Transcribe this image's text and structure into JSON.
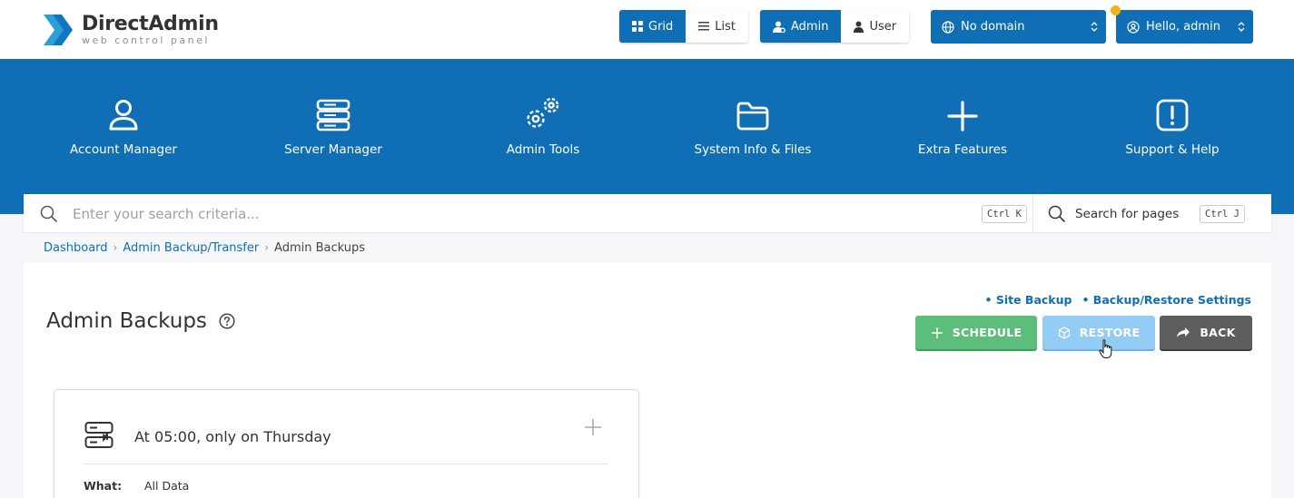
{
  "header": {
    "logo_name": "DirectAdmin",
    "logo_tagline": "web control panel",
    "view_toggle": {
      "grid_label": "Grid",
      "list_label": "List",
      "selected": "Grid"
    },
    "role_toggle": {
      "admin_label": "Admin",
      "user_label": "User",
      "selected": "Admin"
    },
    "domain_select": {
      "value": "No domain"
    },
    "user_menu": {
      "label": "Hello, admin"
    },
    "accent_color": "#0f6eb4",
    "notification_color": "#f3b41b"
  },
  "nav": {
    "items": [
      {
        "label": "Account Manager",
        "icon": "user-icon"
      },
      {
        "label": "Server Manager",
        "icon": "server-stack-icon"
      },
      {
        "label": "Admin Tools",
        "icon": "gears-icon"
      },
      {
        "label": "System Info & Files",
        "icon": "folder-icon"
      },
      {
        "label": "Extra Features",
        "icon": "plus-icon"
      },
      {
        "label": "Support & Help",
        "icon": "exclamation-icon"
      }
    ]
  },
  "search": {
    "placeholder": "Enter your search criteria...",
    "shortcut": "Ctrl K",
    "pages_label": "Search for pages",
    "pages_shortcut": "Ctrl J"
  },
  "breadcrumb": {
    "items": [
      "Dashboard",
      "Admin Backup/Transfer"
    ],
    "current": "Admin Backups"
  },
  "page": {
    "title": "Admin Backups",
    "links": [
      "• Site Backup",
      "• Backup/Restore Settings"
    ],
    "buttons": {
      "schedule": "SCHEDULE",
      "restore": "RESTORE",
      "back": "BACK"
    },
    "button_colors": {
      "schedule": "#5cbe7a",
      "restore": "#93cdf5",
      "back": "#5d5d5d"
    }
  },
  "schedule_card": {
    "title": "At 05:00, only on Thursday",
    "what_label": "What:",
    "what_value": "All Data"
  }
}
